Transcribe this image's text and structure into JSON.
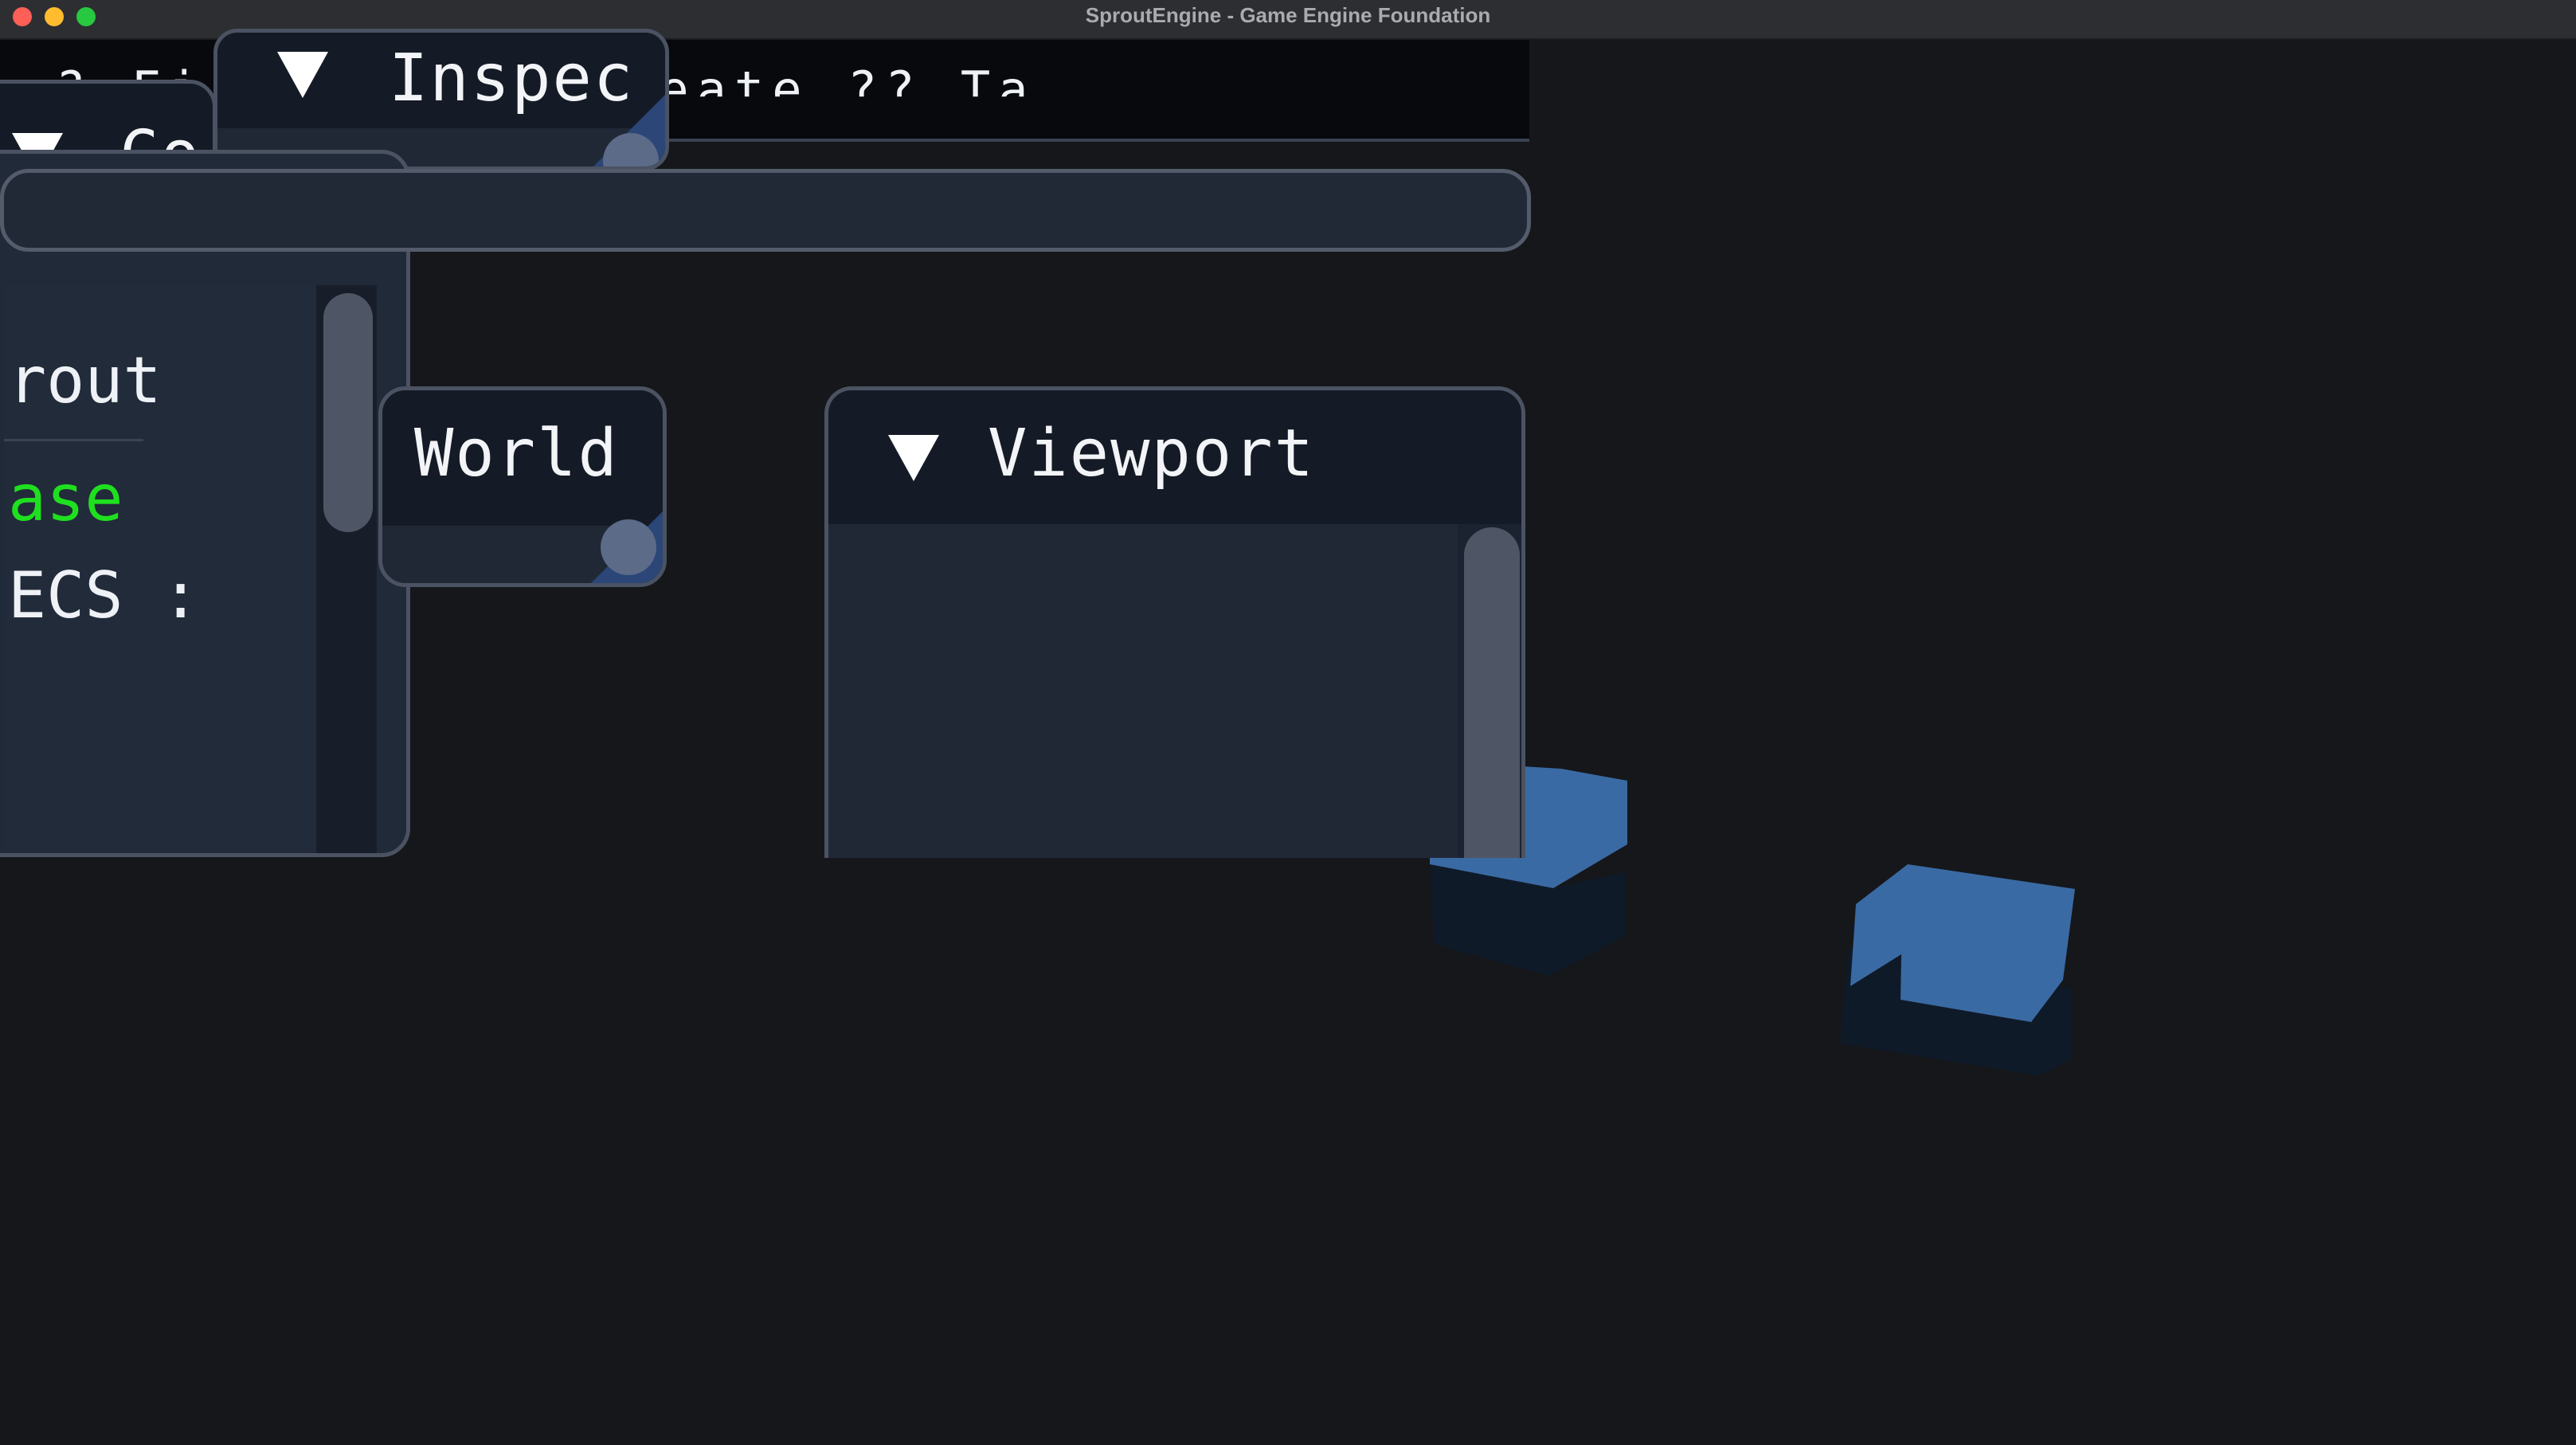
{
  "window": {
    "title": "SproutEngine - Game Engine Foundation"
  },
  "menubar": {
    "text": "? Fi   ?? View?  Create ?? Ta"
  },
  "panels": {
    "inspector": {
      "title": "Inspec"
    },
    "console": {
      "title": "Co"
    },
    "world": {
      "title": "World"
    },
    "viewport": {
      "title": "Viewport"
    }
  },
  "hierarchy": {
    "rows": [
      {
        "label": "rout"
      },
      {
        "label": "ase"
      },
      {
        "label": "ECS :"
      }
    ]
  },
  "colors": {
    "accent_green": "#1fe01f",
    "cube_top": "#3a6aa3",
    "cube_side": "#0f1a28",
    "panel_bg": "#202836",
    "panel_border": "#4b5262"
  }
}
